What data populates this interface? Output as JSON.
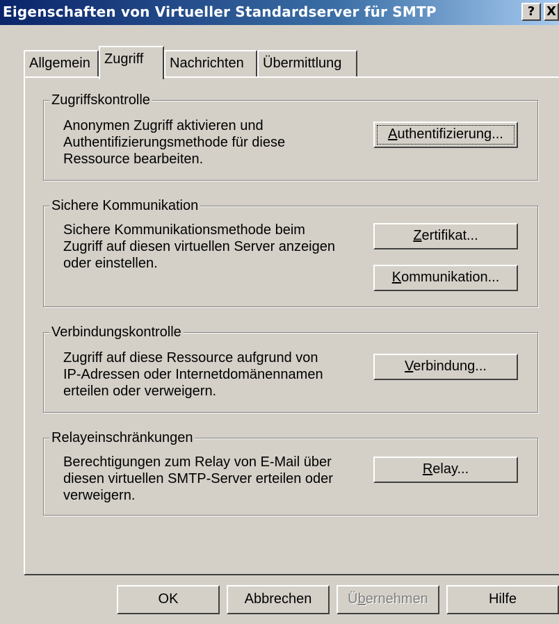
{
  "window": {
    "title": "Eigenschaften von Virtueller Standardserver für SMTP",
    "help_glyph": "?",
    "close_glyph": "X"
  },
  "tabs": [
    {
      "label": "Allgemein",
      "active": false
    },
    {
      "label": "Zugriff",
      "active": true
    },
    {
      "label": "Nachrichten",
      "active": false
    },
    {
      "label": "Übermittlung",
      "active": false
    }
  ],
  "groups": {
    "zugriffskontrolle": {
      "title": "Zugriffskontrolle",
      "lines": [
        "Anonymen Zugriff aktivieren und",
        "Authentifizierungsmethode für diese",
        "Ressource bearbeiten."
      ],
      "button_key": "A",
      "button_rest": "uthentifizierung..."
    },
    "sichere_kommunikation": {
      "title": "Sichere Kommunikation",
      "lines": [
        "Sichere Kommunikationsmethode beim",
        "Zugriff auf diesen virtuellen Server anzeigen",
        "oder einstellen."
      ],
      "button1_key": "Z",
      "button1_rest": "ertifikat...",
      "button2_key": "K",
      "button2_rest": "ommunikation..."
    },
    "verbindungskontrolle": {
      "title": "Verbindungskontrolle",
      "lines": [
        "Zugriff auf diese Ressource aufgrund von",
        "IP-Adressen oder Internetdomänennamen",
        "erteilen oder verweigern."
      ],
      "button_key": "V",
      "button_rest": "erbindung..."
    },
    "relayeinschraenkungen": {
      "title": "Relayeinschränkungen",
      "lines": [
        "Berechtigungen zum Relay von E-Mail über",
        "diesen virtuellen SMTP-Server erteilen oder",
        "verweigern."
      ],
      "button_key": "R",
      "button_rest": "elay..."
    }
  },
  "footer": {
    "ok_label": "OK",
    "cancel_label": "Abbrechen",
    "apply_pre": "Ü",
    "apply_key": "b",
    "apply_rest": "ernehmen",
    "help_label": "Hilfe"
  }
}
